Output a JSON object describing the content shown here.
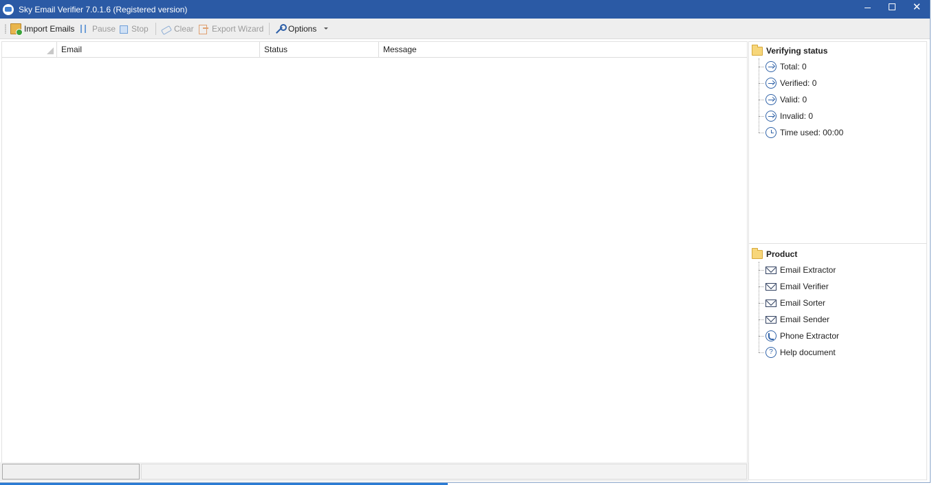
{
  "window": {
    "title": "Sky Email Verifier 7.0.1.6 (Registered version)",
    "controls": {
      "minimize": "minimize-icon",
      "maximize": "maximize-icon",
      "close": "✕"
    }
  },
  "toolbar": {
    "import_label": "Import Emails",
    "pause_label": "Pause",
    "stop_label": "Stop",
    "clear_label": "Clear",
    "export_label": "Export Wizard",
    "options_label": "Options"
  },
  "grid": {
    "columns": [
      "Email",
      "Status",
      "Message"
    ],
    "rows": []
  },
  "side": {
    "verify": {
      "title": "Verifying status",
      "items": [
        {
          "label": "Total: 0",
          "icon": "arrow-circle-icon"
        },
        {
          "label": "Verified: 0",
          "icon": "arrow-circle-icon"
        },
        {
          "label": "Valid: 0",
          "icon": "arrow-circle-icon"
        },
        {
          "label": "Invalid: 0",
          "icon": "arrow-circle-icon"
        },
        {
          "label": "Time used: 00:00",
          "icon": "clock-icon"
        }
      ]
    },
    "product": {
      "title": "Product",
      "items": [
        {
          "label": "Email Extractor",
          "icon": "mail-icon"
        },
        {
          "label": "Email Verifier",
          "icon": "mail-icon"
        },
        {
          "label": "Email Sorter",
          "icon": "mail-icon"
        },
        {
          "label": "Email Sender",
          "icon": "mail-icon"
        },
        {
          "label": "Phone Extractor",
          "icon": "phone-icon"
        },
        {
          "label": "Help document",
          "icon": "help-icon"
        }
      ]
    }
  },
  "statusbar": {
    "left_text": "",
    "right_text": ""
  },
  "colors": {
    "titlebar": "#2b5aa5",
    "toolbar": "#eeeeee",
    "accent": "#2f62a8"
  }
}
